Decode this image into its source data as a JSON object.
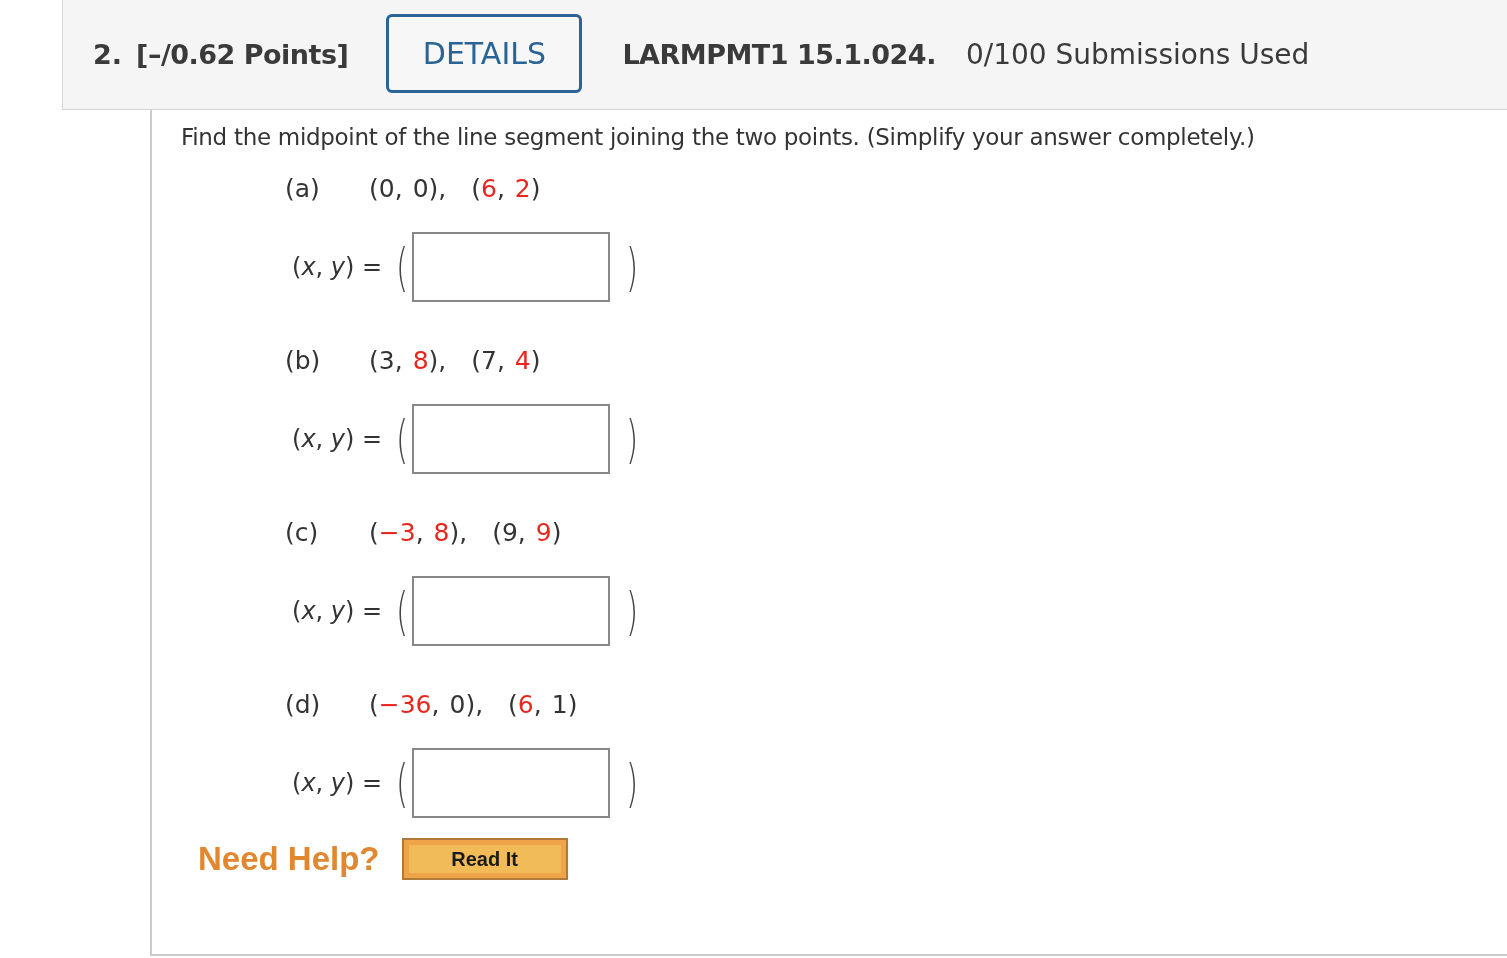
{
  "question": {
    "number": "2.",
    "points": "[–/0.62 Points]",
    "details_button": "DETAILS",
    "code": "LARMPMT1 15.1.024.",
    "submissions": "0/100 Submissions Used"
  },
  "prompt": "Find the midpoint of the line segment joining the two points. (Simplify your answer completely.)",
  "parts": [
    {
      "label": "(a)",
      "points": [
        [
          {
            "text": "(",
            "highlighted": false
          },
          {
            "text": "0",
            "highlighted": false
          },
          {
            "text": ",",
            "highlighted": false
          },
          {
            "text": "0",
            "highlighted": false
          },
          {
            "text": "),",
            "highlighted": false
          }
        ],
        [
          {
            "text": "(",
            "highlighted": false
          },
          {
            "text": "6",
            "highlighted": true
          },
          {
            "text": ",",
            "highlighted": false
          },
          {
            "text": "2",
            "highlighted": true
          },
          {
            "text": ")",
            "highlighted": false
          }
        ]
      ],
      "answer_label": "(*x*, *y*) =",
      "open_paren": "(",
      "close_paren": ")"
    },
    {
      "label": "(b)",
      "points": [
        [
          {
            "text": "(",
            "highlighted": false
          },
          {
            "text": "3",
            "highlighted": false
          },
          {
            "text": ",",
            "highlighted": false
          },
          {
            "text": "8",
            "highlighted": true
          },
          {
            "text": "),",
            "highlighted": false
          }
        ],
        [
          {
            "text": "(",
            "highlighted": false
          },
          {
            "text": "7",
            "highlighted": false
          },
          {
            "text": ",",
            "highlighted": false
          },
          {
            "text": "4",
            "highlighted": true
          },
          {
            "text": ")",
            "highlighted": false
          }
        ]
      ],
      "answer_label": "(*x*, *y*) =",
      "open_paren": "(",
      "close_paren": ")"
    },
    {
      "label": "(c)",
      "points": [
        [
          {
            "text": "(",
            "highlighted": false
          },
          {
            "text": "−3",
            "highlighted": true
          },
          {
            "text": ",",
            "highlighted": false
          },
          {
            "text": "8",
            "highlighted": true
          },
          {
            "text": "),",
            "highlighted": false
          }
        ],
        [
          {
            "text": "(",
            "highlighted": false
          },
          {
            "text": "9",
            "highlighted": false
          },
          {
            "text": ",",
            "highlighted": false
          },
          {
            "text": "9",
            "highlighted": true
          },
          {
            "text": ")",
            "highlighted": false
          }
        ]
      ],
      "answer_label": "(*x*, *y*) =",
      "open_paren": "(",
      "close_paren": ")"
    },
    {
      "label": "(d)",
      "points": [
        [
          {
            "text": "(",
            "highlighted": false
          },
          {
            "text": "−36",
            "highlighted": true
          },
          {
            "text": ",",
            "highlighted": false
          },
          {
            "text": "0",
            "highlighted": false
          },
          {
            "text": "),",
            "highlighted": false
          }
        ],
        [
          {
            "text": "(",
            "highlighted": false
          },
          {
            "text": "6",
            "highlighted": true
          },
          {
            "text": ",",
            "highlighted": false
          },
          {
            "text": "1",
            "highlighted": false
          },
          {
            "text": ")",
            "highlighted": false
          }
        ]
      ],
      "answer_label": "(*x*, *y*) =",
      "open_paren": "(",
      "close_paren": ")"
    }
  ],
  "help": {
    "label": "Need Help?",
    "button": "Read It"
  }
}
